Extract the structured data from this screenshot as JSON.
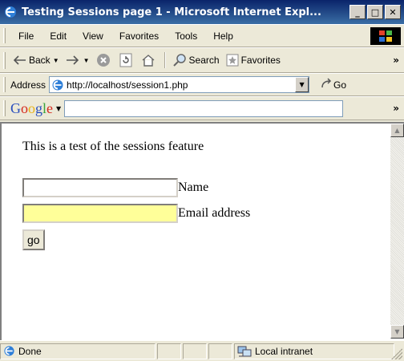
{
  "window": {
    "title": "Testing Sessions page 1 - Microsoft Internet Expl...",
    "buttons": {
      "minimize": "_",
      "maximize": "□",
      "close": "✕"
    }
  },
  "menubar": {
    "items": [
      "File",
      "Edit",
      "View",
      "Favorites",
      "Tools",
      "Help"
    ]
  },
  "toolbar": {
    "back": "Back",
    "search": "Search",
    "favorites": "Favorites",
    "more": "»"
  },
  "address": {
    "label": "Address",
    "url": "http://localhost/session1.php",
    "go": "Go"
  },
  "google": {
    "more": "»"
  },
  "page": {
    "intro": "This is a test of the sessions feature",
    "name_label": "Name",
    "email_label": "Email address",
    "submit": "go"
  },
  "status": {
    "text": "Done",
    "zone": "Local intranet"
  }
}
